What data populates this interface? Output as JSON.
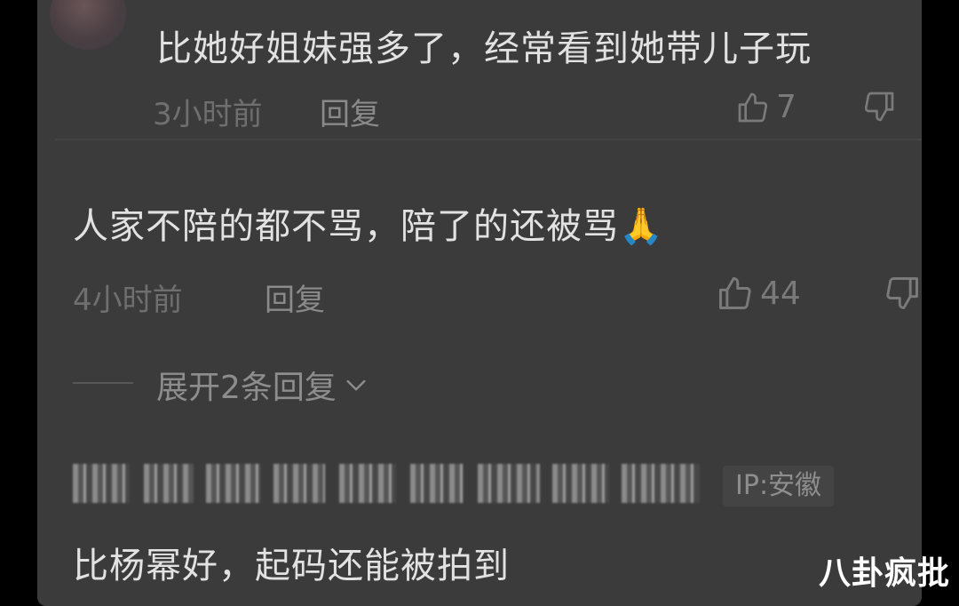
{
  "comments": [
    {
      "text": "比她好姐妹强多了，经常看到她带儿子玩",
      "time": "3小时前",
      "reply_label": "回复",
      "likes": "7"
    },
    {
      "text": "人家不陪的都不骂，陪了的还被骂🙏",
      "time": "4小时前",
      "reply_label": "回复",
      "likes": "44",
      "expand_label": "展开2条回复"
    },
    {
      "ip": "IP:安徽",
      "text": "比杨幂好，起码还能被拍到"
    }
  ],
  "watermark": "八卦疯批",
  "icons": {
    "like": "thumbs-up-icon",
    "dislike": "thumbs-down-icon",
    "expand": "chevron-down-icon"
  },
  "colors": {
    "background": "#3b3b3b",
    "text": "#e2e2e2",
    "meta": "#6f6f6f"
  }
}
